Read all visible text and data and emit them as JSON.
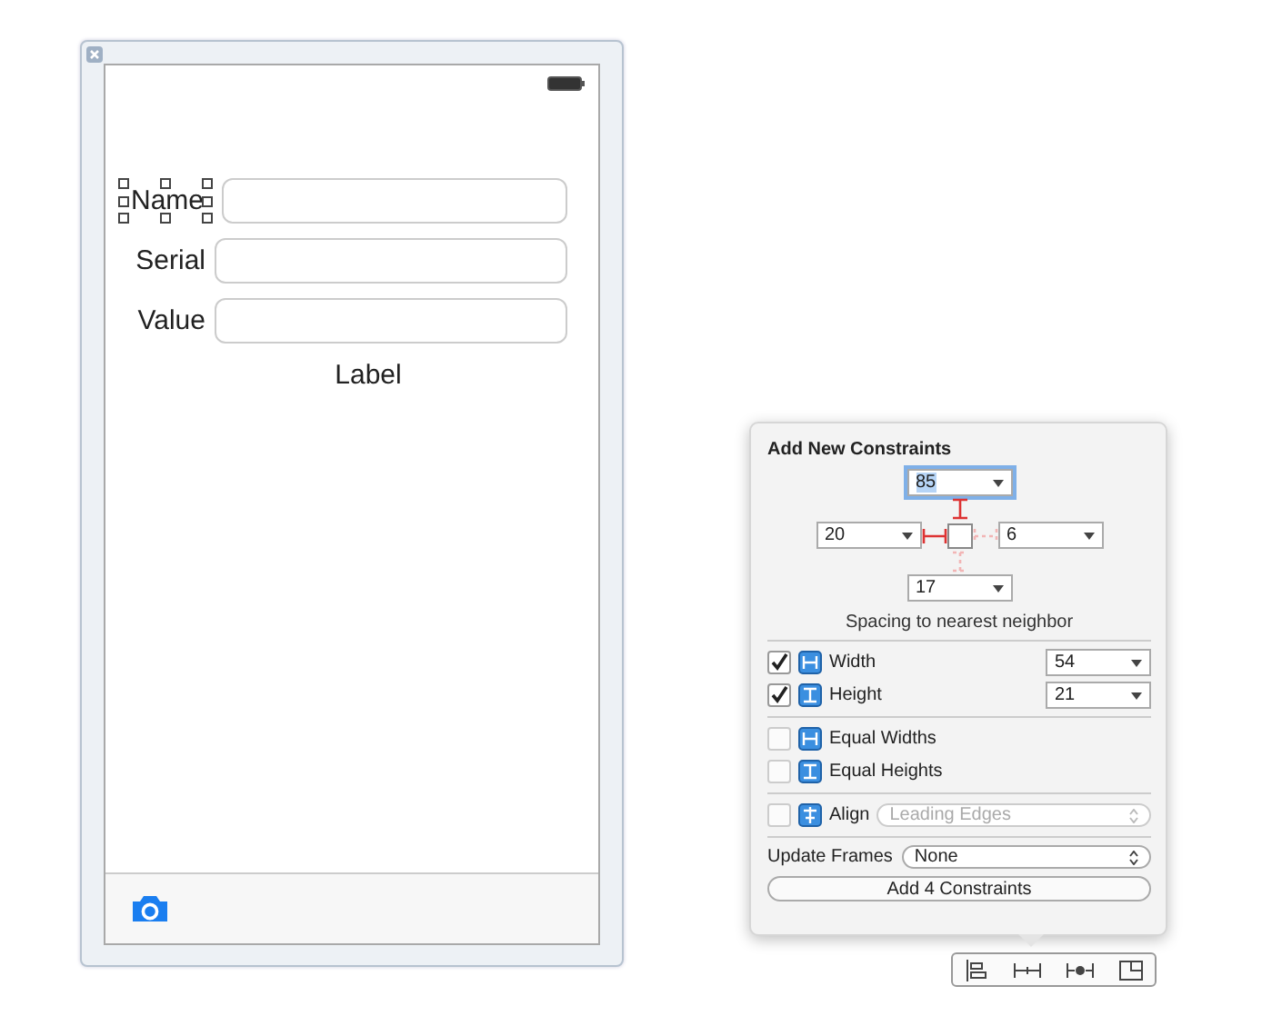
{
  "scene": {
    "rows": [
      {
        "label": "Name",
        "selected": true
      },
      {
        "label": "Serial",
        "selected": false
      },
      {
        "label": "Value",
        "selected": false
      }
    ],
    "label": "Label"
  },
  "popover": {
    "title": "Add New Constraints",
    "spacing": {
      "top": {
        "value": "85",
        "focused": true,
        "on": true
      },
      "left": {
        "value": "20",
        "focused": false,
        "on": true
      },
      "right": {
        "value": "6",
        "focused": false,
        "on": false
      },
      "bottom": {
        "value": "17",
        "focused": false,
        "on": false
      }
    },
    "caption": "Spacing to nearest neighbor",
    "groups": [
      [
        {
          "kind": "size",
          "label": "Width",
          "checked": true,
          "value": "54"
        },
        {
          "kind": "size",
          "label": "Height",
          "checked": true,
          "value": "21"
        }
      ],
      [
        {
          "kind": "equal",
          "label": "Equal Widths",
          "checked": false
        },
        {
          "kind": "equal",
          "label": "Equal Heights",
          "checked": false
        }
      ],
      [
        {
          "kind": "align",
          "label": "Align",
          "checked": false,
          "value": "Leading Edges",
          "disabled": true
        }
      ]
    ],
    "update_frames": {
      "label": "Update Frames",
      "value": "None"
    },
    "button": "Add 4 Constraints"
  }
}
